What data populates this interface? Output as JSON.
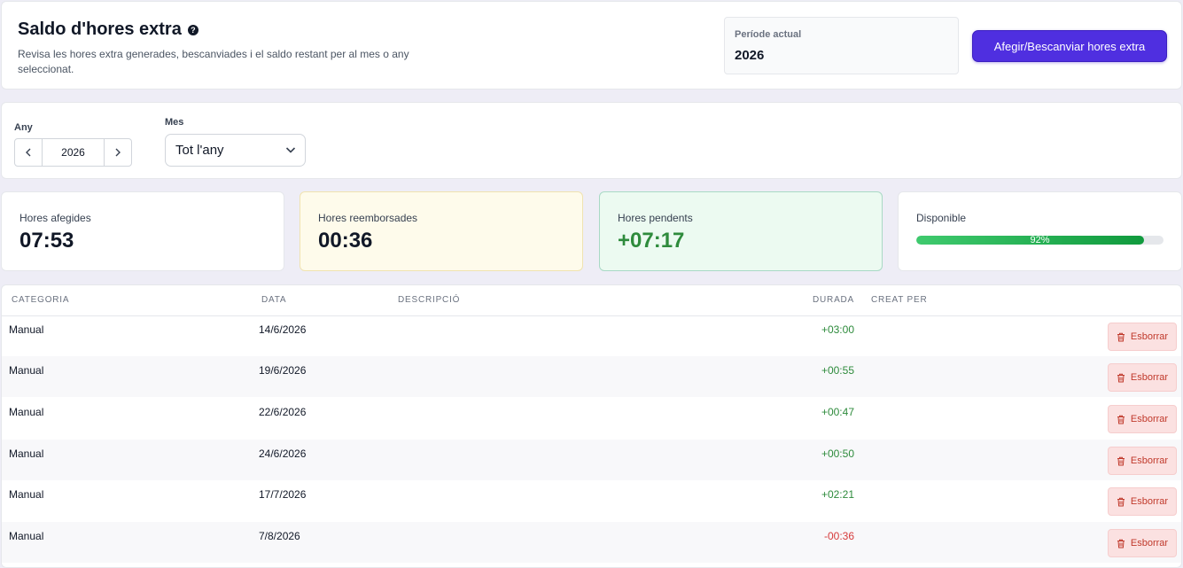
{
  "header": {
    "title": "Saldo d'hores extra",
    "help_icon": "question-circle-icon",
    "description": "Revisa les hores extra generades, bescanviades i el saldo restant per al mes o any seleccionat.",
    "period_label": "Període actual",
    "period_value": "2026",
    "add_button_label": "Afegir/Bescanviar hores extra"
  },
  "filters": {
    "year_label": "Any",
    "year_value": "2026",
    "prev_icon": "chevron-left-icon",
    "next_icon": "chevron-right-icon",
    "month_label": "Mes",
    "month_value": "Tot l'any"
  },
  "stats": {
    "added_label": "Hores afegides",
    "added_value": "07:53",
    "refunded_label": "Hores reemborsades",
    "refunded_value": "00:36",
    "pending_label": "Hores pendents",
    "pending_value": "+07:17",
    "available_label": "Disponible",
    "available_percent": 92,
    "available_text": "92%"
  },
  "table": {
    "columns": [
      "CATEGORIA",
      "DATA",
      "DESCRIPCIÓ",
      "DURADA",
      "CREAT PER"
    ],
    "delete_label": "Esborrar",
    "rows": [
      {
        "category": "Manual",
        "date": "14/6/2026",
        "description": "",
        "duration": "+03:00",
        "sign": "pos",
        "created_by": ""
      },
      {
        "category": "Manual",
        "date": "19/6/2026",
        "description": "",
        "duration": "+00:55",
        "sign": "pos",
        "created_by": ""
      },
      {
        "category": "Manual",
        "date": "22/6/2026",
        "description": "",
        "duration": "+00:47",
        "sign": "pos",
        "created_by": ""
      },
      {
        "category": "Manual",
        "date": "24/6/2026",
        "description": "",
        "duration": "+00:50",
        "sign": "pos",
        "created_by": ""
      },
      {
        "category": "Manual",
        "date": "17/7/2026",
        "description": "",
        "duration": "+02:21",
        "sign": "pos",
        "created_by": ""
      },
      {
        "category": "Manual",
        "date": "7/8/2026",
        "description": "",
        "duration": "-00:36",
        "sign": "neg",
        "created_by": ""
      }
    ]
  },
  "colors": {
    "accent": "#4f2fe0",
    "positive": "#2e8b3c",
    "negative": "#d63b3b",
    "delete_bg": "#fbe1e1"
  }
}
